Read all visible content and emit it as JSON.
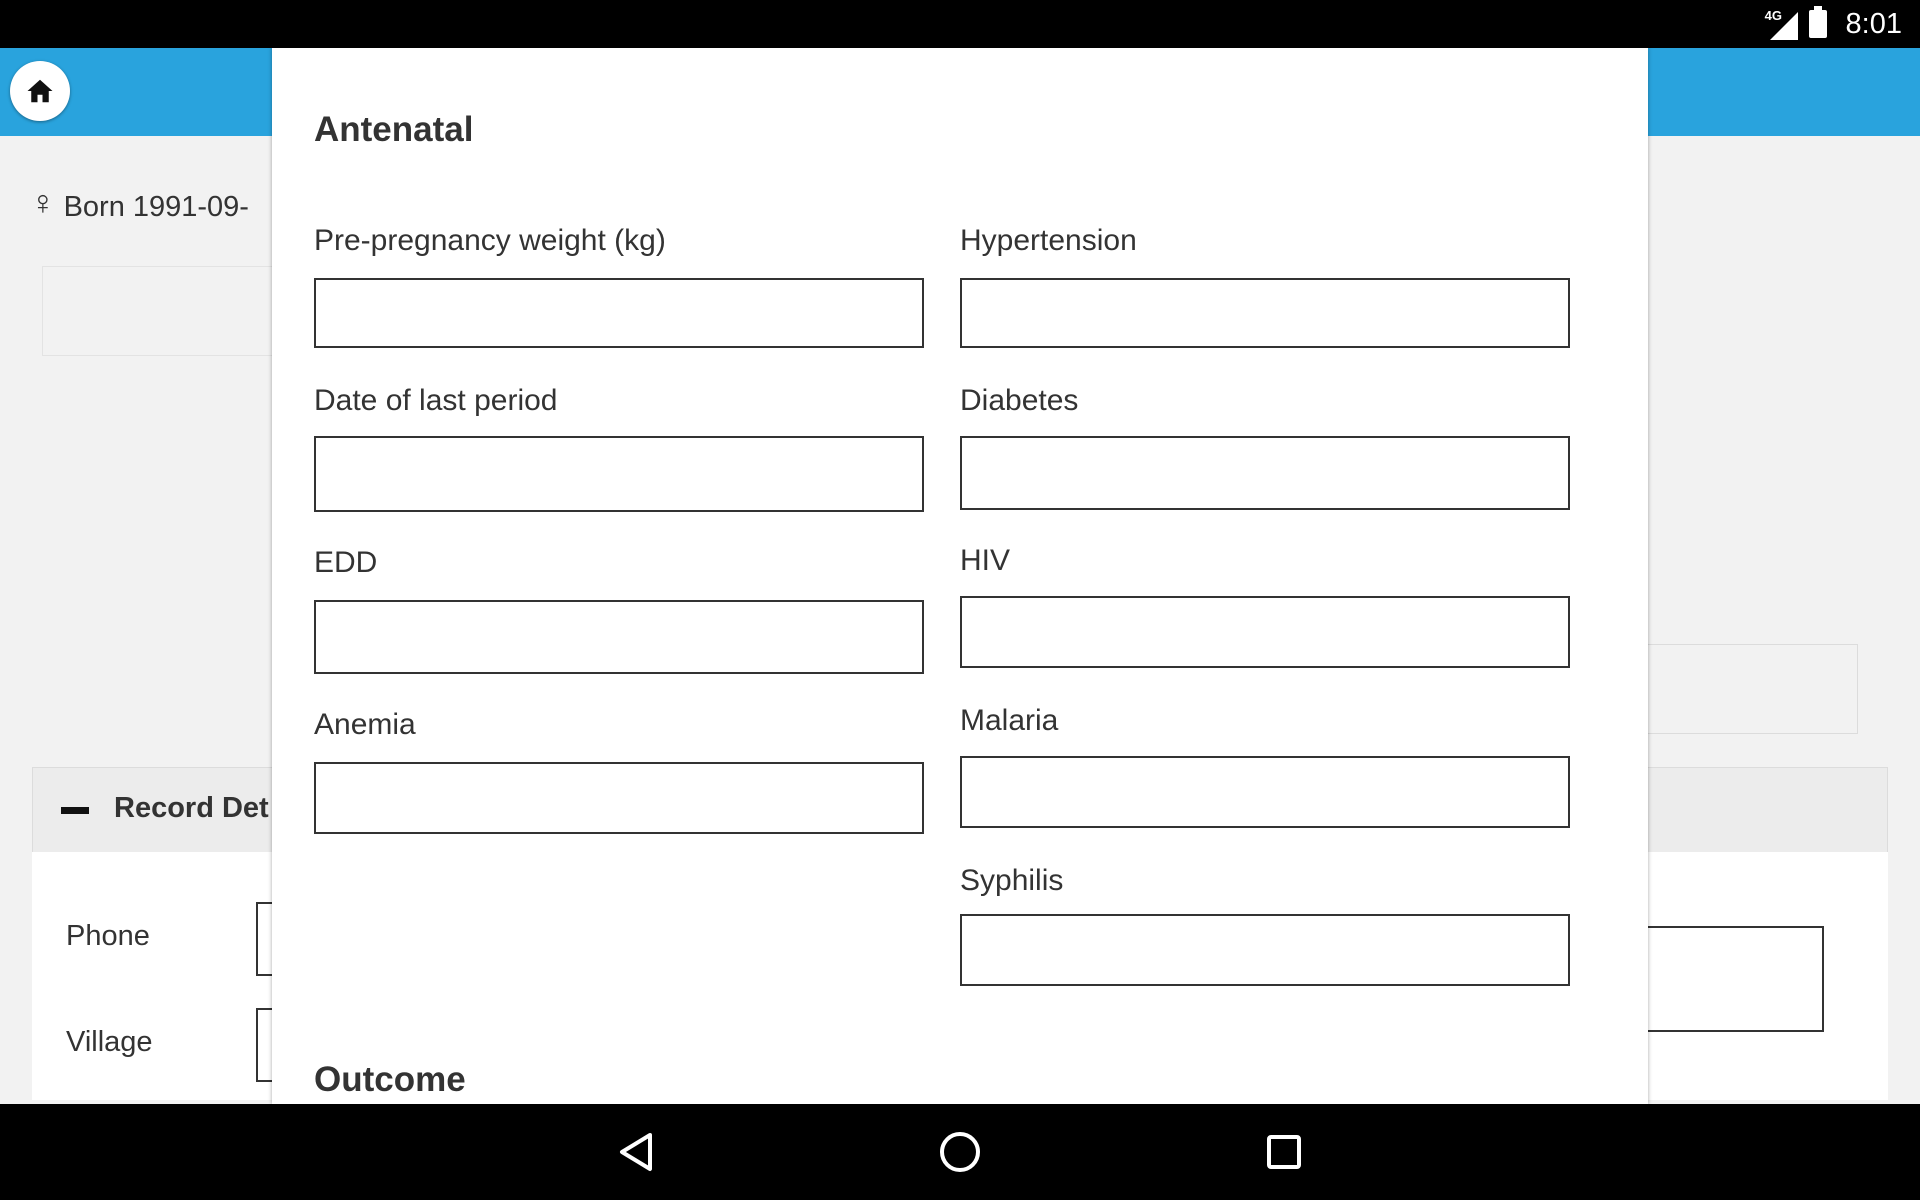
{
  "status_bar": {
    "network": "4G",
    "time": "8:01"
  },
  "header": {
    "home_icon": "home-icon"
  },
  "background": {
    "born_text": "Born 1991-09-",
    "section_title": "Record Det",
    "phone_label": "Phone",
    "village_label": "Village"
  },
  "modal": {
    "antenatal_title": "Antenatal",
    "outcome_title": "Outcome",
    "fields": {
      "pre_pregnancy_weight": {
        "label": "Pre-pregnancy weight (kg)",
        "value": ""
      },
      "date_last_period": {
        "label": "Date of last period",
        "value": ""
      },
      "edd": {
        "label": "EDD",
        "value": ""
      },
      "anemia": {
        "label": "Anemia",
        "value": ""
      },
      "hypertension": {
        "label": "Hypertension",
        "value": ""
      },
      "diabetes": {
        "label": "Diabetes",
        "value": ""
      },
      "hiv": {
        "label": "HIV",
        "value": ""
      },
      "malaria": {
        "label": "Malaria",
        "value": ""
      },
      "syphilis": {
        "label": "Syphilis",
        "value": ""
      }
    }
  },
  "nav_bar": {
    "back_icon": "back-icon",
    "home_icon": "home-circle-icon",
    "recents_icon": "recents-icon"
  }
}
